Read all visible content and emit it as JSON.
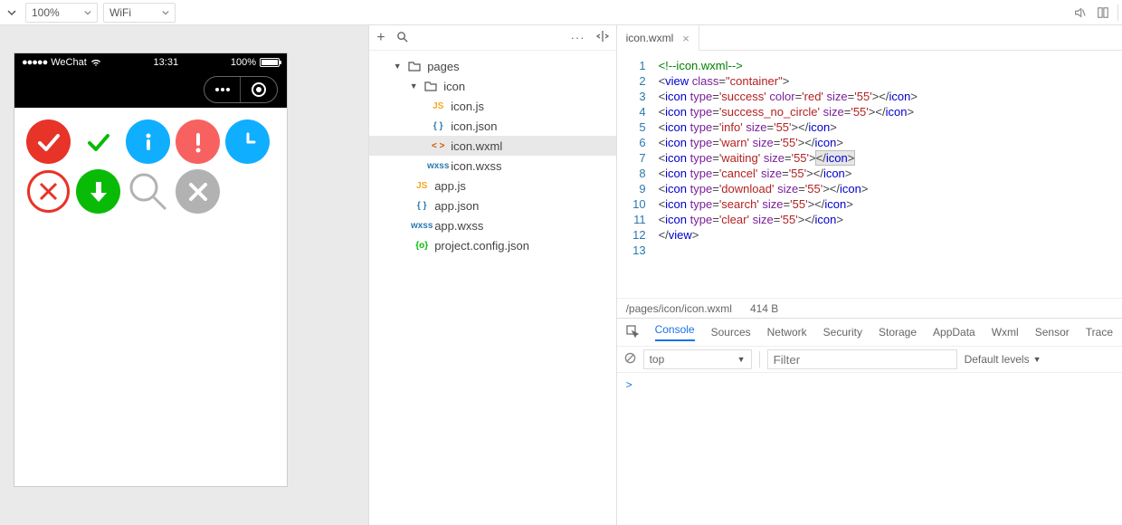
{
  "toolbar": {
    "zoom": "100%",
    "network": "WiFi"
  },
  "simulator": {
    "carrier": "WeChat",
    "time": "13:31",
    "battery": "100%",
    "icons": [
      {
        "type": "success",
        "bg": "#e73328",
        "stroke": "#fff",
        "shape": "check-filled"
      },
      {
        "type": "success_no_circle",
        "bg": "transparent",
        "stroke": "#09bb07",
        "shape": "check"
      },
      {
        "type": "info",
        "bg": "#10aeff",
        "stroke": "#fff",
        "shape": "info"
      },
      {
        "type": "warn",
        "bg": "#f76260",
        "stroke": "#fff",
        "shape": "excl"
      },
      {
        "type": "waiting",
        "bg": "#10aeff",
        "stroke": "#fff",
        "shape": "clock"
      },
      {
        "type": "cancel",
        "bg": "#fff",
        "stroke": "#e73328",
        "shape": "x-outline"
      },
      {
        "type": "download",
        "bg": "#09bb07",
        "stroke": "#fff",
        "shape": "down"
      },
      {
        "type": "search",
        "bg": "transparent",
        "stroke": "#b2b2b2",
        "shape": "search"
      },
      {
        "type": "clear",
        "bg": "#b2b2b2",
        "stroke": "#fff",
        "shape": "x"
      }
    ]
  },
  "tree": [
    {
      "depth": 0,
      "open": true,
      "kind": "folder",
      "color": "#555",
      "tag": "",
      "name": "pages"
    },
    {
      "depth": 1,
      "open": true,
      "kind": "folder",
      "color": "#555",
      "tag": "",
      "name": "icon"
    },
    {
      "depth": 2,
      "kind": "file",
      "tag": "JS",
      "color": "#f5a623",
      "name": "icon.js"
    },
    {
      "depth": 2,
      "kind": "file",
      "tag": "{ }",
      "color": "#2a7ab0",
      "name": "icon.json"
    },
    {
      "depth": 2,
      "kind": "file",
      "tag": "< >",
      "color": "#d35400",
      "name": "icon.wxml",
      "selected": true
    },
    {
      "depth": 2,
      "kind": "file",
      "tag": "wxss",
      "color": "#2a7ab0",
      "name": "icon.wxss"
    },
    {
      "depth": 1,
      "kind": "file",
      "tag": "JS",
      "color": "#f5a623",
      "name": "app.js"
    },
    {
      "depth": 1,
      "kind": "file",
      "tag": "{ }",
      "color": "#2a7ab0",
      "name": "app.json"
    },
    {
      "depth": 1,
      "kind": "file",
      "tag": "wxss",
      "color": "#2a7ab0",
      "name": "app.wxss"
    },
    {
      "depth": 1,
      "kind": "file",
      "tag": "{o}",
      "color": "#09bb07",
      "name": "project.config.json"
    }
  ],
  "editor": {
    "tab_label": "icon.wxml",
    "file_path": "/pages/icon/icon.wxml",
    "file_size": "414 B",
    "lines": [
      {
        "n": 1,
        "html": "<span class='c-comment'>&lt;!--icon.wxml--&gt;</span>"
      },
      {
        "n": 2,
        "html": "<span class='c-punct'>&lt;</span><span class='c-tag'>view</span> <span class='c-attr'>class</span><span class='c-punct'>=</span><span class='c-val'>\"container\"</span><span class='c-punct'>&gt;</span>"
      },
      {
        "n": 3,
        "html": "<span class='c-punct'>&lt;</span><span class='c-tag'>icon</span> <span class='c-attr'>type</span><span class='c-punct'>=</span><span class='c-val'>'success'</span> <span class='c-attr'>color</span><span class='c-punct'>=</span><span class='c-val'>'red'</span> <span class='c-attr'>size</span><span class='c-punct'>=</span><span class='c-val'>'55'</span><span class='c-punct'>&gt;&lt;/</span><span class='c-tag'>icon</span><span class='c-punct'>&gt;</span>"
      },
      {
        "n": 4,
        "html": "<span class='c-punct'>&lt;</span><span class='c-tag'>icon</span> <span class='c-attr'>type</span><span class='c-punct'>=</span><span class='c-val'>'success_no_circle'</span> <span class='c-attr'>size</span><span class='c-punct'>=</span><span class='c-val'>'55'</span><span class='c-punct'>&gt;&lt;/</span><span class='c-tag'>icon</span><span class='c-punct'>&gt;</span>"
      },
      {
        "n": 5,
        "html": "<span class='c-punct'>&lt;</span><span class='c-tag'>icon</span> <span class='c-attr'>type</span><span class='c-punct'>=</span><span class='c-val'>'info'</span> <span class='c-attr'>size</span><span class='c-punct'>=</span><span class='c-val'>'55'</span><span class='c-punct'>&gt;&lt;/</span><span class='c-tag'>icon</span><span class='c-punct'>&gt;</span>"
      },
      {
        "n": 6,
        "html": "<span class='c-punct'>&lt;</span><span class='c-tag'>icon</span> <span class='c-attr'>type</span><span class='c-punct'>=</span><span class='c-val'>'warn'</span> <span class='c-attr'>size</span><span class='c-punct'>=</span><span class='c-val'>'55'</span><span class='c-punct'>&gt;&lt;/</span><span class='c-tag'>icon</span><span class='c-punct'>&gt;</span>"
      },
      {
        "n": 7,
        "html": "<span class='c-punct'>&lt;</span><span class='c-tag'>icon</span> <span class='c-attr'>type</span><span class='c-punct'>=</span><span class='c-val'>'waiting'</span> <span class='c-attr'>size</span><span class='c-punct'>=</span><span class='c-val'>'55'</span><span class='c-punct'>&gt;</span><span class='sel-range'><span class='c-punct'>&lt;/</span><span class='c-tag'>icon</span><span class='c-punct'>&gt;</span></span>"
      },
      {
        "n": 8,
        "html": "<span class='c-punct'>&lt;</span><span class='c-tag'>icon</span> <span class='c-attr'>type</span><span class='c-punct'>=</span><span class='c-val'>'cancel'</span> <span class='c-attr'>size</span><span class='c-punct'>=</span><span class='c-val'>'55'</span><span class='c-punct'>&gt;&lt;/</span><span class='c-tag'>icon</span><span class='c-punct'>&gt;</span>"
      },
      {
        "n": 9,
        "html": "<span class='c-punct'>&lt;</span><span class='c-tag'>icon</span> <span class='c-attr'>type</span><span class='c-punct'>=</span><span class='c-val'>'download'</span> <span class='c-attr'>size</span><span class='c-punct'>=</span><span class='c-val'>'55'</span><span class='c-punct'>&gt;&lt;/</span><span class='c-tag'>icon</span><span class='c-punct'>&gt;</span>"
      },
      {
        "n": 10,
        "html": "<span class='c-punct'>&lt;</span><span class='c-tag'>icon</span> <span class='c-attr'>type</span><span class='c-punct'>=</span><span class='c-val'>'search'</span> <span class='c-attr'>size</span><span class='c-punct'>=</span><span class='c-val'>'55'</span><span class='c-punct'>&gt;&lt;/</span><span class='c-tag'>icon</span><span class='c-punct'>&gt;</span>"
      },
      {
        "n": 11,
        "html": "<span class='c-punct'>&lt;</span><span class='c-tag'>icon</span> <span class='c-attr'>type</span><span class='c-punct'>=</span><span class='c-val'>'clear'</span> <span class='c-attr'>size</span><span class='c-punct'>=</span><span class='c-val'>'55'</span><span class='c-punct'>&gt;&lt;/</span><span class='c-tag'>icon</span><span class='c-punct'>&gt;</span>"
      },
      {
        "n": 12,
        "html": "<span class='c-punct'>&lt;/</span><span class='c-tag'>view</span><span class='c-punct'>&gt;</span>"
      },
      {
        "n": 13,
        "html": ""
      }
    ]
  },
  "devtools": {
    "tabs": [
      "Console",
      "Sources",
      "Network",
      "Security",
      "Storage",
      "AppData",
      "Wxml",
      "Sensor",
      "Trace"
    ],
    "active_tab": "Console",
    "context": "top",
    "filter_placeholder": "Filter",
    "levels": "Default levels",
    "prompt": ">"
  }
}
